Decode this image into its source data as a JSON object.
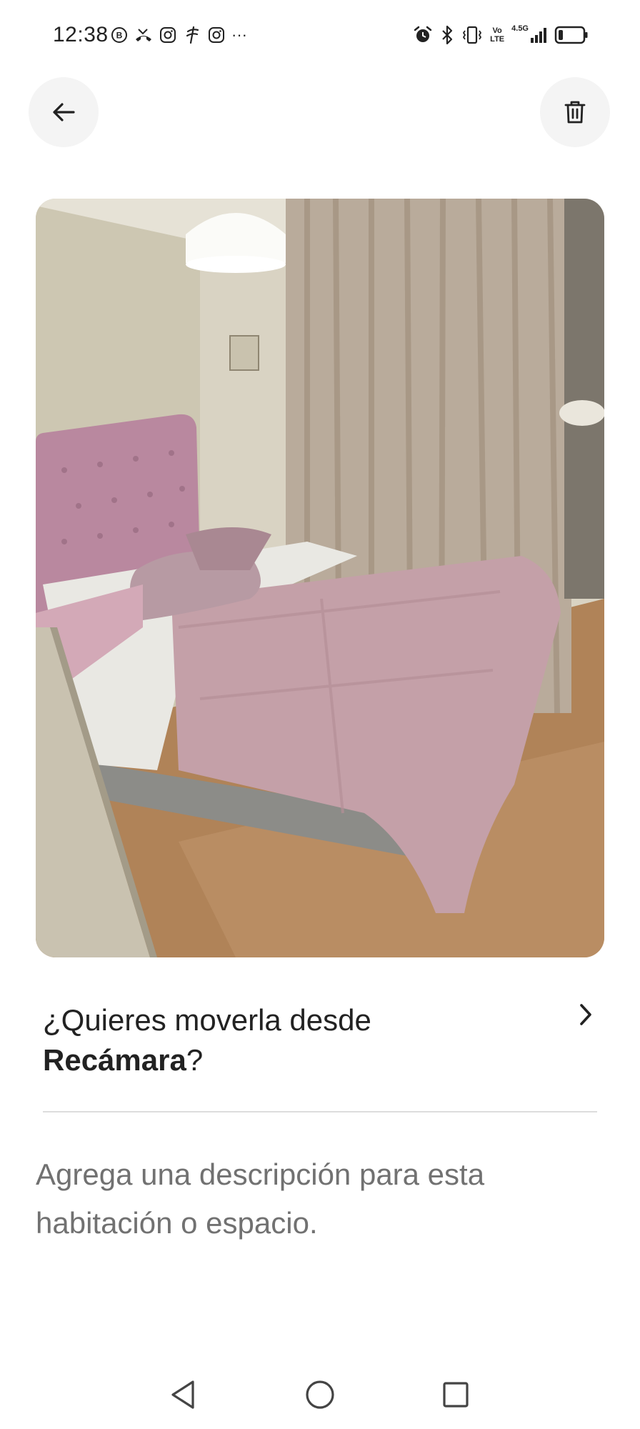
{
  "status_bar": {
    "time": "12:38",
    "left_icons": [
      "b-circle-icon",
      "missed-call-icon",
      "instagram-icon",
      "fork-icon",
      "instagram-icon"
    ],
    "more": "···",
    "right_icons": [
      "alarm-icon",
      "bluetooth-icon",
      "vibrate-icon"
    ],
    "vo_lte_top": "Vo",
    "vo_lte_bottom": "LTE",
    "network_type": "4.5G",
    "battery_level": 0.2
  },
  "header": {
    "back_icon": "arrow-left-icon",
    "delete_icon": "trash-icon"
  },
  "photo": {
    "subject": "bedroom-photo"
  },
  "move_prompt": {
    "prefix": "¿Quieres moverla desde ",
    "room": "Recámara",
    "suffix": "?",
    "chevron_icon": "chevron-right-icon"
  },
  "description": {
    "placeholder": "Agrega una descripción para esta habitación o espacio."
  },
  "nav_bar": {
    "back_icon": "triangle-back-icon",
    "home_icon": "circle-home-icon",
    "recent_icon": "square-recents-icon"
  },
  "colors": {
    "text_primary": "#222222",
    "text_secondary": "#717171",
    "divider": "#dddddd",
    "button_bg": "#f4f4f4"
  }
}
